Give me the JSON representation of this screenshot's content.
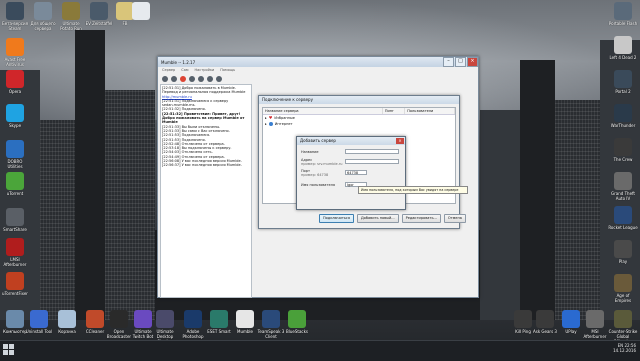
{
  "desktop": {
    "left_icons": [
      {
        "label": "Avast Free Antivirus",
        "color": "#f07a1c"
      },
      {
        "label": "Opera",
        "color": "#d0262a"
      },
      {
        "label": "Skype",
        "color": "#1fa3e2"
      },
      {
        "label": "DOBRO Utilities",
        "color": "#2b6fc0"
      },
      {
        "label": "uTorrent",
        "color": "#4ba53a"
      },
      {
        "label": "SmartShare",
        "color": "#5a5f66"
      },
      {
        "label": "LMSI Afterburner",
        "color": "#b01d1d"
      },
      {
        "label": "uTorrentFixer",
        "color": "#c04020"
      }
    ],
    "top_icons": [
      {
        "label": "Бета-версия Steam",
        "color": "#3a4b5c"
      },
      {
        "label": "Для общего сервера",
        "color": "#7a8a9a"
      },
      {
        "label": "Ultimate Potato Run",
        "color": "#8a7a3a"
      },
      {
        "label": "EV Zeitstaffel",
        "color": "#4a5a6a"
      },
      {
        "label": "FB",
        "color": "#d9c57a"
      },
      {
        "label": "",
        "color": "#e6eaee"
      }
    ],
    "right_icons": [
      {
        "label": "Portable Flash",
        "color": "#5a6a7a"
      },
      {
        "label": "Left 4 Dead 2",
        "color": "#c8c8c8"
      },
      {
        "label": "Portal 2",
        "color": "#3a4a5a"
      },
      {
        "label": "WarThunder",
        "color": "#2a3a4a"
      },
      {
        "label": "The Crew",
        "color": "#3a3a3a"
      },
      {
        "label": "Grand Theft Auto IV",
        "color": "#6a6a6a"
      },
      {
        "label": "Rocket League",
        "color": "#2a4a7a"
      },
      {
        "label": "Play",
        "color": "#4a4a4a"
      },
      {
        "label": "Age of Empires",
        "color": "#6a5a3a"
      }
    ],
    "bottom_icons": [
      {
        "label": "Компьютер",
        "color": "#6a8aaa"
      },
      {
        "label": "Uninstall Tool",
        "color": "#3a6ad0"
      },
      {
        "label": "Корзина",
        "color": "#a8c0d8"
      },
      {
        "label": "CCleaner",
        "color": "#c04a2a"
      },
      {
        "label": "Open Broadcaster",
        "color": "#2a2a2a"
      },
      {
        "label": "Ultimate Twitch Bot",
        "color": "#6a4ac0"
      },
      {
        "label": "Ultimate Desktop Sharing",
        "color": "#4a4a6a"
      },
      {
        "label": "Adobe Photoshop",
        "color": "#1a3a6a"
      },
      {
        "label": "ESET Smart",
        "color": "#2a7a6a"
      },
      {
        "label": "Mumble",
        "color": "#e6e6e6"
      },
      {
        "label": "TeamSpeak 3 Client",
        "color": "#2a4a7a"
      },
      {
        "label": "BlueStacks",
        "color": "#4aa03a"
      }
    ],
    "bottom_right_icons": [
      {
        "label": "Kill Ping",
        "color": "#3a3a3a"
      },
      {
        "label": "Ask Gears 3",
        "color": "#3a3a3a"
      },
      {
        "label": "UPlay",
        "color": "#2a6ad0"
      },
      {
        "label": "MSI Afterburner",
        "color": "#6a6a6a"
      },
      {
        "label": "Counter-Strike Global Offensive",
        "color": "#5a5a3a"
      }
    ]
  },
  "mumble": {
    "title": "Mumble -- 1.2.17",
    "menu": [
      "Сервер",
      "Сам",
      "Настройки",
      "Помощь"
    ],
    "log": [
      {
        "text": "[22:51:31] Добро пожаловать в Mumble.",
        "bold": false
      },
      {
        "text": "Перевод и региональная поддержка Mumble",
        "bold": false
      },
      {
        "text": "http://mumble.ru",
        "link": true
      },
      {
        "text": "[22:51:31] Подключаемся к серверу",
        "bold": false
      },
      {
        "text": "sedan.mumble.ms.",
        "bold": false
      },
      {
        "text": "[22:51:32] Подключено.",
        "bold": false
      },
      {
        "text": "[22:51:32] Приветствие: Привет, друг!",
        "bold": true
      },
      {
        "text": "Добро пожаловать на сервер Mumble от",
        "bold": true
      },
      {
        "text": "Mumble",
        "bold": true
      },
      {
        "text": "[22:51:33] Вы были отключены.",
        "bold": false
      },
      {
        "text": "[22:51:33] Вы сами с Вас отключено.",
        "bold": false
      },
      {
        "text": "[22:51:53] Подключаемся.",
        "bold": false
      },
      {
        "text": "[22:51:53] Подключено.",
        "bold": false
      },
      {
        "text": "[22:52:48] Отключено от сервера.",
        "bold": false
      },
      {
        "text": "[22:53:18] Вы подключены к серверу.",
        "bold": false
      },
      {
        "text": "[22:54:03] Отключено сеть.",
        "bold": false
      },
      {
        "text": "[22:54:49] Отключено от сервера.",
        "bold": false
      },
      {
        "text": "[22:56:08] У вас последняя версия Mumble.",
        "bold": false
      },
      {
        "text": "[22:56:37] У вас последняя версия Mumble.",
        "bold": false
      }
    ]
  },
  "connect_dialog": {
    "title": "Подключение к серверу",
    "columns": [
      "Название сервера",
      "Пинг",
      "Пользователи"
    ],
    "rows": [
      {
        "label": "Избранные",
        "icon": "heart"
      },
      {
        "label": "Интернет",
        "icon": "globe"
      }
    ],
    "buttons": {
      "connect": "Подключиться",
      "add": "Добавить новый...",
      "edit": "Редактировать...",
      "cancel": "Отмена"
    }
  },
  "add_dialog": {
    "title": "Добавить сервер",
    "fields": {
      "name_label": "Название",
      "address_label": "Адрес",
      "address_hint": "пример: srv.mumble.ru",
      "port_label": "Порт",
      "port_hint": "пример: 64738",
      "port_value": "64738",
      "user_label": "Имя пользователя",
      "user_value": "Igor"
    },
    "tooltip": "Имя пользователя, под которым Вас увидят на сервере"
  },
  "taskbar": {
    "lang": "EN",
    "time": "22:56",
    "date": "14.12.2016"
  }
}
